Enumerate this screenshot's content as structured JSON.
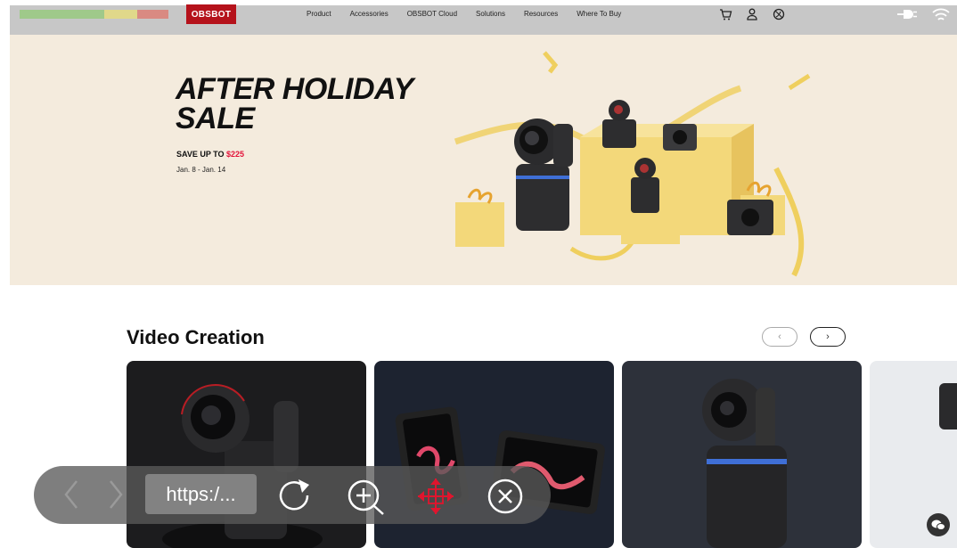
{
  "topbar": {
    "logo": "OBSBOT",
    "nav": [
      "Product",
      "Accessories",
      "OBSBOT Cloud",
      "Solutions",
      "Resources",
      "Where To Buy"
    ],
    "icons": [
      "cart-icon",
      "user-icon",
      "globe-icon"
    ],
    "system_icons": [
      "plug-icon",
      "wifi-icon"
    ]
  },
  "hero": {
    "title_line1": "AFTER HOLIDAY",
    "title_line2": "SALE",
    "save_text": "SAVE UP TO ",
    "save_amount": "$225",
    "dates": "Jan. 8 - Jan. 14"
  },
  "section": {
    "title": "Video Creation",
    "prev_label": "‹",
    "next_label": "›"
  },
  "browser": {
    "url": "https:/...",
    "buttons": [
      "back-icon",
      "forward-icon",
      "reload-icon",
      "zoom-in-icon",
      "move-icon",
      "close-icon"
    ]
  },
  "colors": {
    "brand": "#b5121b",
    "hero_bg": "#f4ebdd",
    "price": "#e3133a",
    "move_icon": "#e0152e"
  }
}
